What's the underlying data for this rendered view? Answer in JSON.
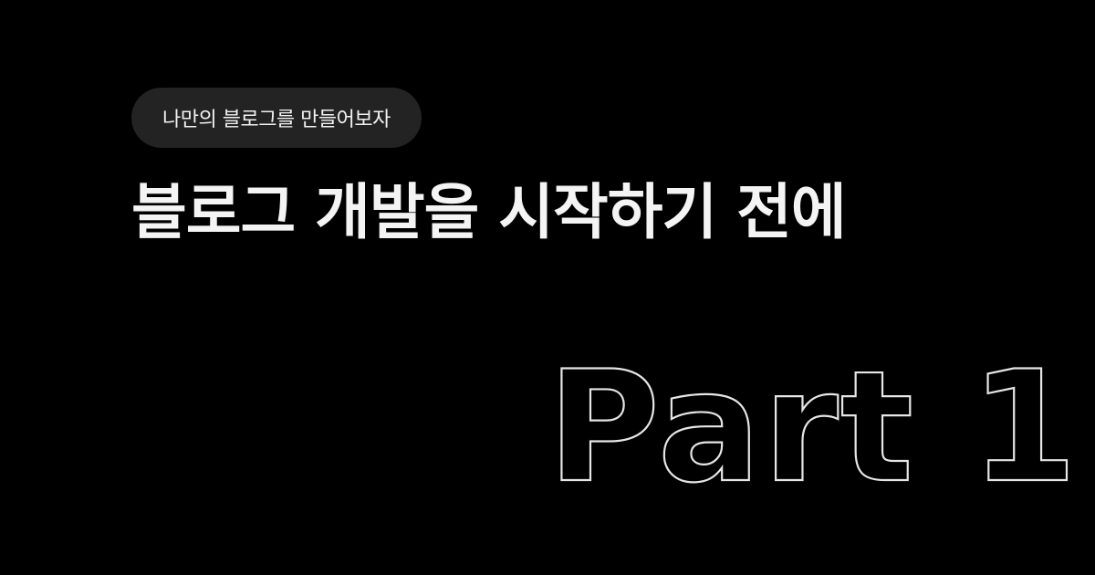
{
  "series_badge": {
    "label": "나만의 블로그를 만들어보자"
  },
  "headline": {
    "text": "블로그 개발을 시작하기 전에"
  },
  "part_label": {
    "text": "Part 1"
  },
  "colors": {
    "background": "#000000",
    "badge_background": "#232323",
    "text": "#f4f4f4",
    "outline": "#e6e6e6"
  }
}
